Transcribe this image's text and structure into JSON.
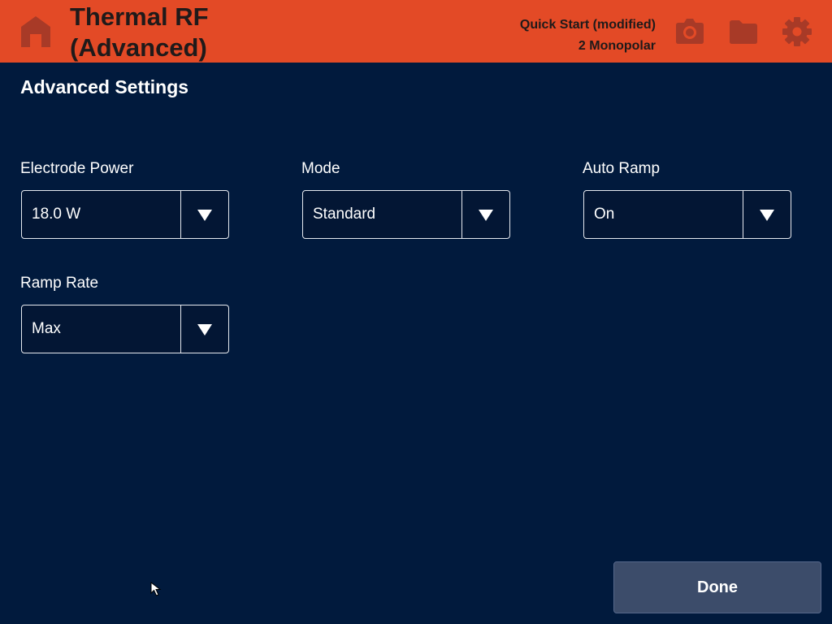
{
  "header": {
    "title_line1": "Thermal RF",
    "title_line2": "(Advanced)",
    "preset": "Quick Start (modified)",
    "electrode_config": "2 Monopolar",
    "bar_color": "#e34a26",
    "icons": [
      "home-icon",
      "camera-icon",
      "folder-icon",
      "gear-icon"
    ]
  },
  "page": {
    "title": "Advanced Settings"
  },
  "settings": {
    "electrode_power": {
      "label": "Electrode Power",
      "value": "18.0 W"
    },
    "mode": {
      "label": "Mode",
      "value": "Standard"
    },
    "auto_ramp": {
      "label": "Auto Ramp",
      "value": "On"
    },
    "ramp_rate": {
      "label": "Ramp Rate",
      "value": "Max"
    }
  },
  "footer": {
    "done_label": "Done"
  },
  "colors": {
    "background": "#011a3d",
    "header": "#e34a26",
    "header_icon": "#a83a27",
    "button": "#3c4c6a"
  }
}
